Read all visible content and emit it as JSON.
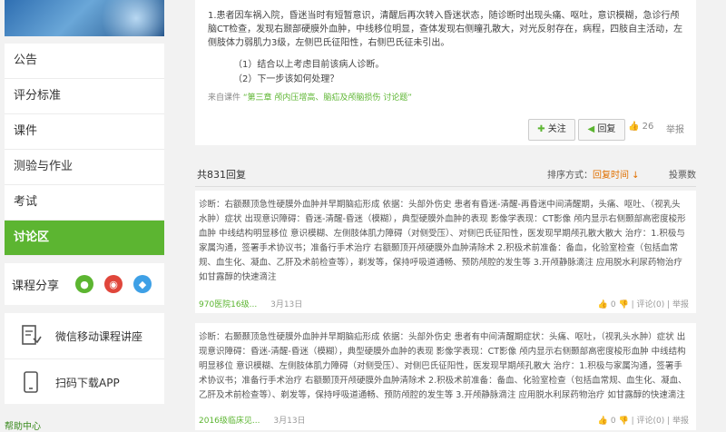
{
  "sidebar": {
    "menu": [
      {
        "label": "公告",
        "active": false
      },
      {
        "label": "评分标准",
        "active": false
      },
      {
        "label": "课件",
        "active": false
      },
      {
        "label": "测验与作业",
        "active": false
      },
      {
        "label": "考试",
        "active": false
      },
      {
        "label": "讨论区",
        "active": true
      }
    ],
    "share_label": "课程分享",
    "apps": [
      {
        "label": "微信移动课程讲座"
      },
      {
        "label": "扫码下载APP"
      }
    ],
    "help": "帮助中心"
  },
  "post": {
    "body": "1.患者因车祸入院，昏迷当时有短暂意识，清醒后再次转入昏迷状态，随诊断时出现头痛、呕吐，意识模糊，急诊行颅脑CT检查，发现右颞部硬膜外血肿，中线移位明显，查体发现右侧瞳孔散大，对光反射存在，病程，四肢自主活动，左侧肢体力弱肌力3级，左侧巴氏征阳性，右侧巴氏征未引出。",
    "q1": "（1）结合以上考虑目前该病人诊断。",
    "q2": "（2）下一步该如何处理？",
    "from_prefix": "来自课件",
    "from_link": "“第三章 颅内压增高、脑疝及颅脑损伤 讨论题”",
    "follow": "关注",
    "reply": "回复",
    "likes": "26",
    "report": "举报"
  },
  "replies_head": {
    "count": "共831回复",
    "sort_label": "排序方式：",
    "sort_value": "回复时间",
    "sort_alt": "投票数"
  },
  "replies": [
    {
      "text": "诊断：右额颞顶急性硬膜外血肿并早期脑疝形成 依据：头部外伤史 患者有昏迷-清醒-再昏迷中间清醒期，头痛、呕吐、（视乳头水肿）症状 出现意识障碍：昏迷-清醒-昏迷（模糊），典型硬膜外血肿的表现 影像学表现：CT影像 颅内显示右侧颞部高密度梭形血肿 中线结构明显移位 意识模糊、左侧肢体肌力障碍（对侧受压）、对侧巴氏征阳性，医发现早期颅孔散大散大 治疗：1.积极与家属沟通，签署手术协议书；准备行手术治疗 右额颞顶开颅硬膜外血肿清除术 2.积极术前准备：备血，化验室检查（包括血常规、血生化、凝血、乙肝及术前检查等），剃发等，保持呼吸道通畅、预防颅腔的发生等 3.开颅静脉滴注 应用脱水利尿药物治疗 如甘露醇的快速滴注",
      "author": "970医院16级...",
      "date": "3月13日",
      "likes": "0",
      "comments": "评论(0)",
      "report": "举报"
    },
    {
      "text": "诊断：右颞颞顶急性硬膜外血肿并早期脑疝形成 依据：头部外伤史 患者有中间清醒期症状：头痛、呕吐，（视乳头水肿）症状 出现意识障碍：昏迷-清醒-昏迷（模糊），典型硬膜外血肿的表现 影像学表现：CT影像 颅内显示右侧颞部高密度梭形血肿 中线结构明显移位 意识模糊、左侧肢体肌力障碍（对侧受压）、对侧巴氏征阳性，医发现早期颅孔散大 治疗：1.积极与家属沟通，签署手术协议书；准备行手术治疗 右额颞顶开颅硬膜外血肿清除术 2.积极术前准备：备血、化验室检查（包括血常规、血生化、凝血、乙肝及术前检查等）、剃发等，保持呼吸道通畅、预防颅腔的发生等 3.开颅静脉滴注 应用脱水利尿药物治疗 如甘露醇的快速滴注",
      "author": "2016级临床见...",
      "date": "3月13日",
      "likes": "0",
      "comments": "评论(0)",
      "report": "举报"
    }
  ]
}
